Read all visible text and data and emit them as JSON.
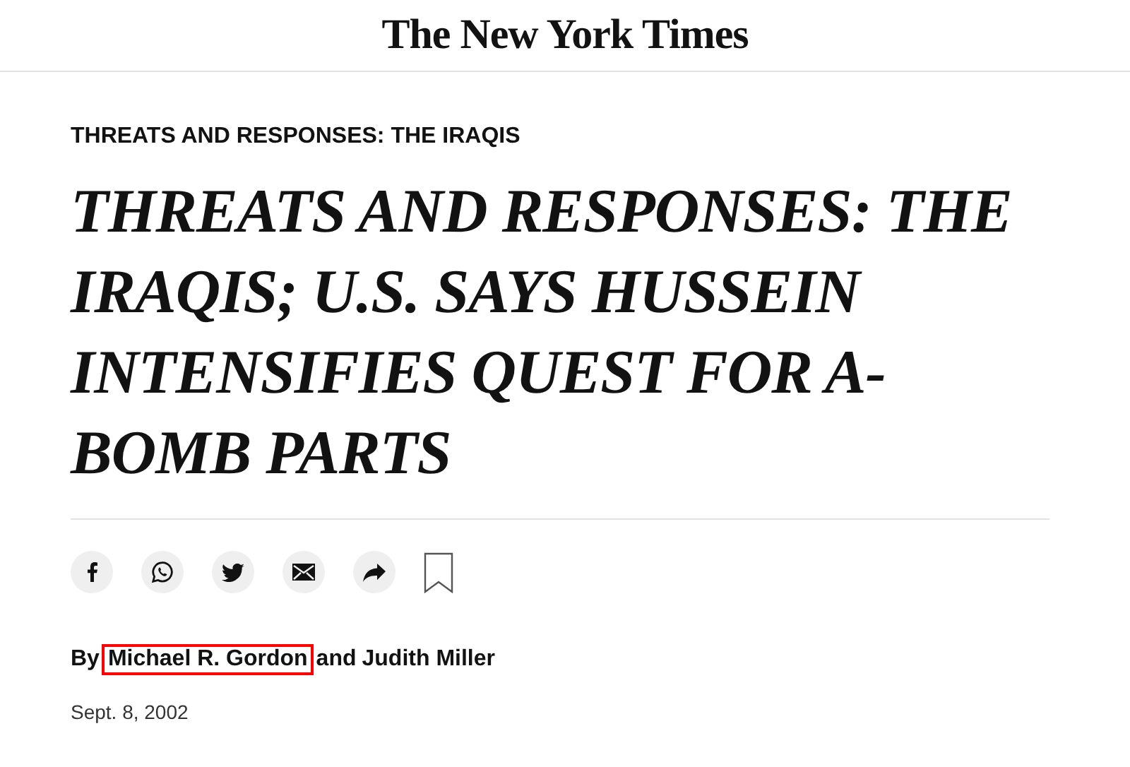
{
  "masthead": {
    "logo": "The New York Times"
  },
  "kicker": "THREATS AND RESPONSES: THE IRAQIS",
  "headline": "THREATS AND RESPONSES: THE IRAQIS; U.S. SAYS HUSSEIN INTENSIFIES QUEST FOR A-BOMB PARTS",
  "share_buttons": [
    {
      "kind": "facebook"
    },
    {
      "kind": "whatsapp"
    },
    {
      "kind": "twitter"
    },
    {
      "kind": "email"
    },
    {
      "kind": "share"
    },
    {
      "kind": "bookmark"
    }
  ],
  "byline": {
    "prefix": "By",
    "authors": [
      {
        "name": "Michael R. Gordon",
        "highlighted": true
      },
      {
        "name": "Judith Miller",
        "highlighted": false
      }
    ],
    "joiner": "and"
  },
  "date": "Sept. 8, 2002"
}
